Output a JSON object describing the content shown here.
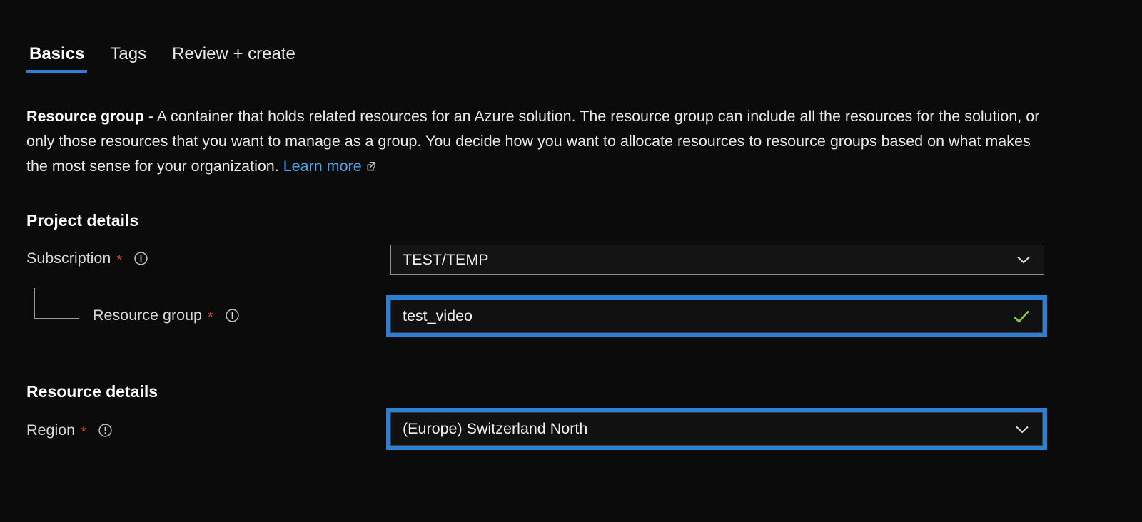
{
  "tabs": [
    {
      "label": "Basics",
      "active": true
    },
    {
      "label": "Tags",
      "active": false
    },
    {
      "label": "Review + create",
      "active": false
    }
  ],
  "description": {
    "bold_lead": "Resource group",
    "body": " - A container that holds related resources for an Azure solution. The resource group can include all the resources for the solution, or only those resources that you want to manage as a group. You decide how you want to allocate resources to resource groups based on what makes the most sense for your organization. ",
    "link_label": "Learn more",
    "link_icon": "external-link-icon"
  },
  "sections": {
    "project_details": {
      "heading": "Project details",
      "subscription": {
        "label": "Subscription",
        "required_marker": "*",
        "info_icon": "info-icon",
        "value": "TEST/TEMP",
        "chevron_icon": "chevron-down-icon"
      },
      "resource_group": {
        "label": "Resource group",
        "required_marker": "*",
        "info_icon": "info-icon",
        "value": "test_video",
        "validation_icon": "check-icon",
        "highlighted": true
      }
    },
    "resource_details": {
      "heading": "Resource details",
      "region": {
        "label": "Region",
        "required_marker": "*",
        "info_icon": "info-icon",
        "value": "(Europe) Switzerland North",
        "chevron_icon": "chevron-down-icon",
        "highlighted": true
      }
    }
  },
  "colors": {
    "background": "#0b0b0b",
    "accent_blue": "#2b7fd4",
    "link_blue": "#4aa3e8",
    "required_red": "#e04a3f",
    "validation_green": "#8dc63f",
    "text_primary": "#ffffff",
    "text_secondary": "#d6d6d6",
    "control_border": "#8d8d8d"
  }
}
